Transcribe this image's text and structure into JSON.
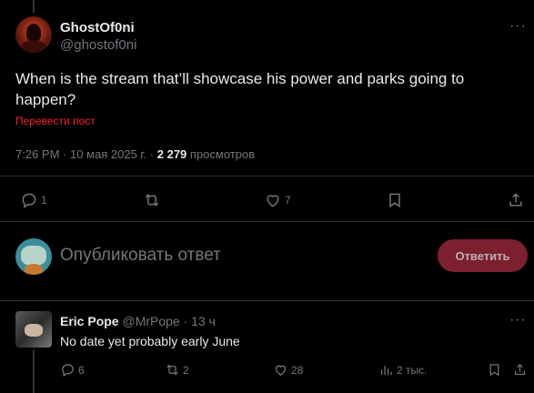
{
  "post": {
    "display_name": "GhostOf0ni",
    "handle": "@ghostof0ni",
    "more": "···",
    "text": "When is the stream that’ll showcase his power and parks going to happen?",
    "translate": "Перевести пост",
    "time": "7:26 PM",
    "sep1": " · ",
    "date": "10 мая 2025 г.",
    "sep2": " · ",
    "views": "2 279",
    "views_label": " просмотров",
    "actions": {
      "reply_count": "1",
      "retweet_count": "",
      "like_count": "7"
    }
  },
  "composer": {
    "placeholder": "Опубликовать ответ",
    "button": "Ответить"
  },
  "reply": {
    "display_name": "Eric Pope",
    "handle": "@MrPope",
    "time": " · 13 ч",
    "text": "No date yet probably early June",
    "more": "···",
    "actions": {
      "reply_count": "6",
      "retweet_count": "2",
      "like_count": "28",
      "views_count": "2 тыс."
    }
  },
  "icons": {
    "reply": "reply-icon",
    "retweet": "retweet-icon",
    "like": "heart-icon",
    "bookmark": "bookmark-icon",
    "share": "share-icon",
    "views": "views-icon"
  },
  "colors": {
    "background": "#000000",
    "text": "#e7e9ea",
    "secondary": "#71767b",
    "translate": "#f4212e",
    "reply_button": "#7c1f2f",
    "divider": "#2f3336"
  }
}
